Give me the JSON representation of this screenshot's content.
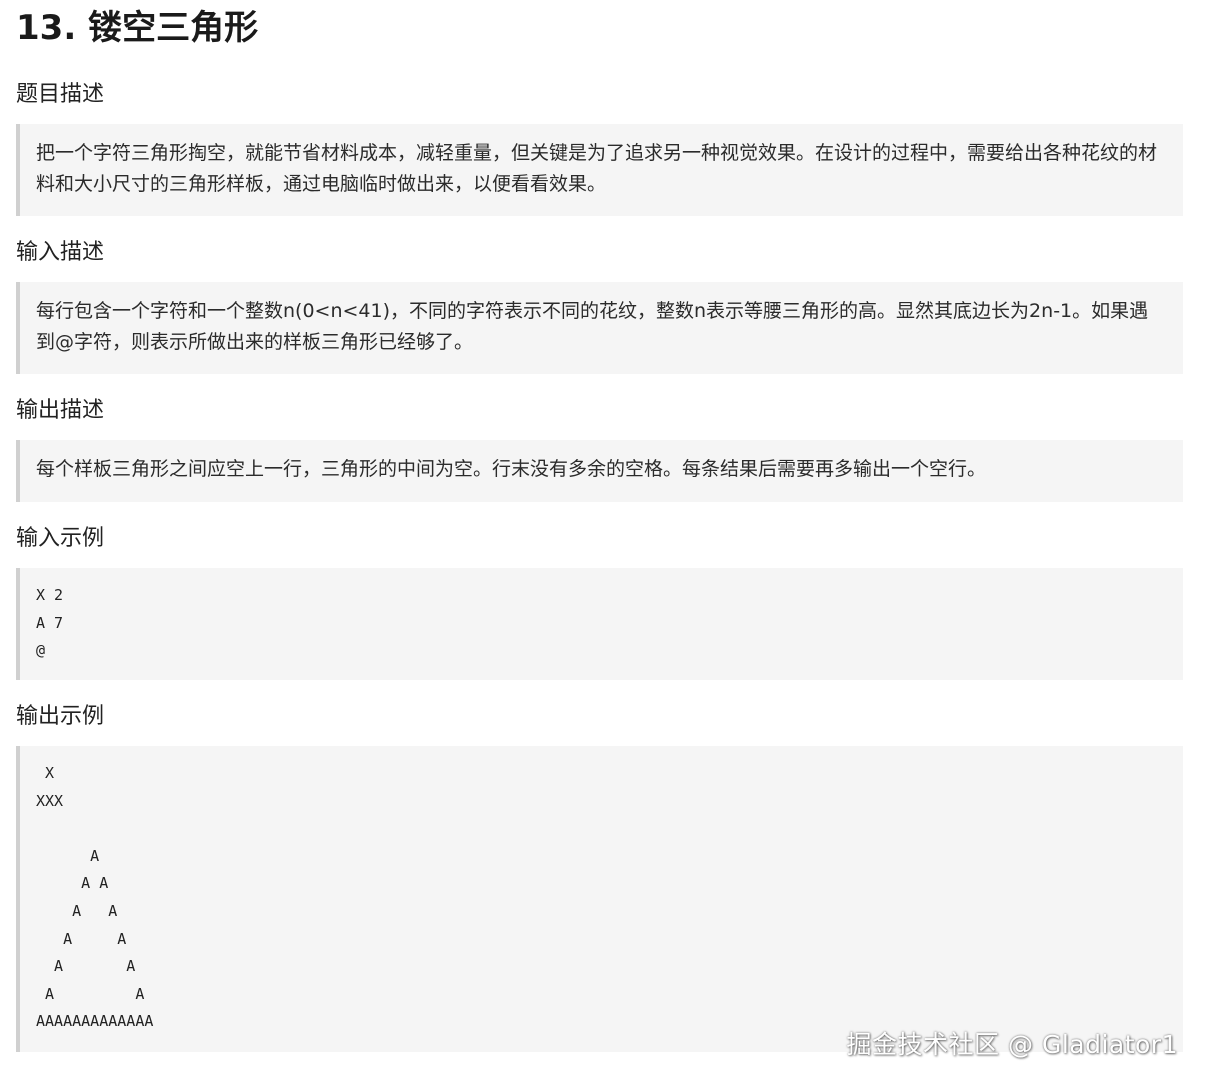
{
  "title": "13. 镂空三角形",
  "sections": {
    "description": {
      "heading": "题目描述",
      "text": "把一个字符三角形掏空，就能节省材料成本，减轻重量，但关键是为了追求另一种视觉效果。在设计的过程中，需要给出各种花纹的材料和大小尺寸的三角形样板，通过电脑临时做出来，以便看看效果。"
    },
    "input": {
      "heading": "输入描述",
      "text": "每行包含一个字符和一个整数n(0<n<41)，不同的字符表示不同的花纹，整数n表示等腰三角形的高。显然其底边长为2n-1。如果遇到@字符，则表示所做出来的样板三角形已经够了。"
    },
    "output": {
      "heading": "输出描述",
      "text": "每个样板三角形之间应空上一行，三角形的中间为空。行末没有多余的空格。每条结果后需要再多输出一个空行。"
    },
    "sample_input": {
      "heading": "输入示例",
      "code": "X 2\nA 7\n@"
    },
    "sample_output": {
      "heading": "输出示例",
      "code": " X\nXXX\n\n      A\n     A A\n    A   A\n   A     A\n  A       A\n A         A\nAAAAAAAAAAAAA"
    }
  },
  "watermark": "掘金技术社区 @ Gladiator1"
}
